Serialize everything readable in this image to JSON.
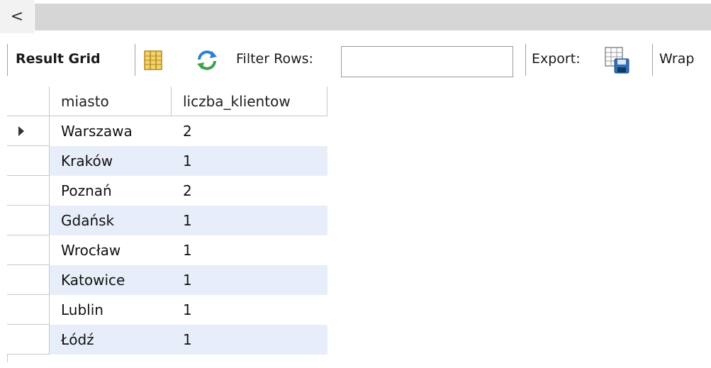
{
  "scroll": {
    "left_arrow_glyph": "<"
  },
  "toolbar": {
    "result_grid_label": "Result Grid",
    "filter_label": "Filter Rows:",
    "filter_value": "",
    "export_label": "Export:",
    "wrap_label": "Wrap"
  },
  "grid": {
    "columns": [
      "miasto",
      "liczba_klientow"
    ],
    "rows": [
      {
        "miasto": "Warszawa",
        "liczba_klientow": "2",
        "current": true
      },
      {
        "miasto": "Kraków",
        "liczba_klientow": "1",
        "current": false
      },
      {
        "miasto": "Poznań",
        "liczba_klientow": "2",
        "current": false
      },
      {
        "miasto": "Gdańsk",
        "liczba_klientow": "1",
        "current": false
      },
      {
        "miasto": "Wrocław",
        "liczba_klientow": "1",
        "current": false
      },
      {
        "miasto": "Katowice",
        "liczba_klientow": "1",
        "current": false
      },
      {
        "miasto": "Lublin",
        "liczba_klientow": "1",
        "current": false
      },
      {
        "miasto": "Łódź",
        "liczba_klientow": "1",
        "current": false
      }
    ]
  },
  "colors": {
    "alt_row": "#e8eef9",
    "scroll_track": "#d6d6d6",
    "refresh_icon": "#2d7fd6"
  }
}
